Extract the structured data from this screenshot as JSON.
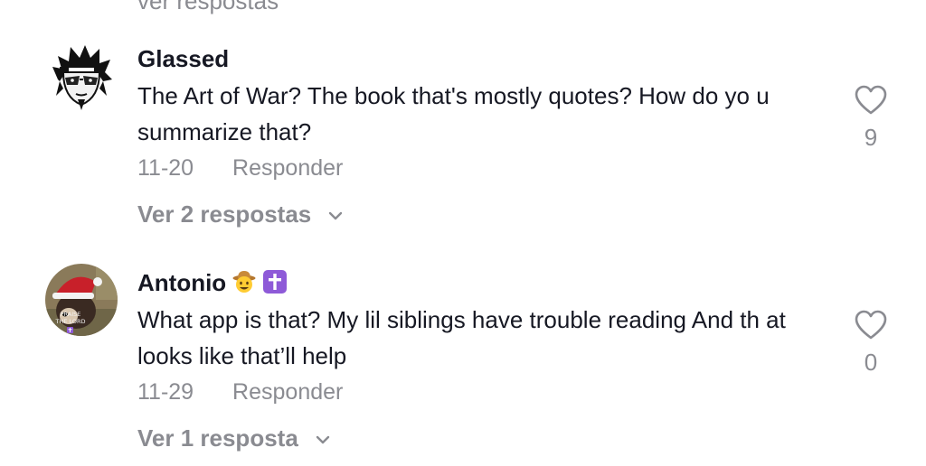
{
  "cutoff_text": "ver respostas",
  "comments": [
    {
      "username": "Glassed",
      "text": "The Art of War? The book that's mostly quotes? How do yo u summarize that?",
      "date": "11-20",
      "reply_label": "Responder",
      "view_replies_label": "Ver 2 respostas",
      "likes": "9",
      "avatar": "anime-character-avatar"
    },
    {
      "username": "Antonio",
      "username_emojis": [
        "cowboy-face-emoji",
        "latin-cross-emoji"
      ],
      "text": "What app is that? My lil siblings have trouble reading And th at looks like that’ll help",
      "date": "11-29",
      "reply_label": "Responder",
      "view_replies_label": "Ver 1 resposta",
      "likes": "0",
      "avatar": "santa-hat-dog-avatar",
      "avatar_caption": "PRAISE THE LORD"
    }
  ],
  "colors": {
    "primary_text": "#161823",
    "secondary_text": "#8a8b91",
    "background": "#ffffff"
  }
}
